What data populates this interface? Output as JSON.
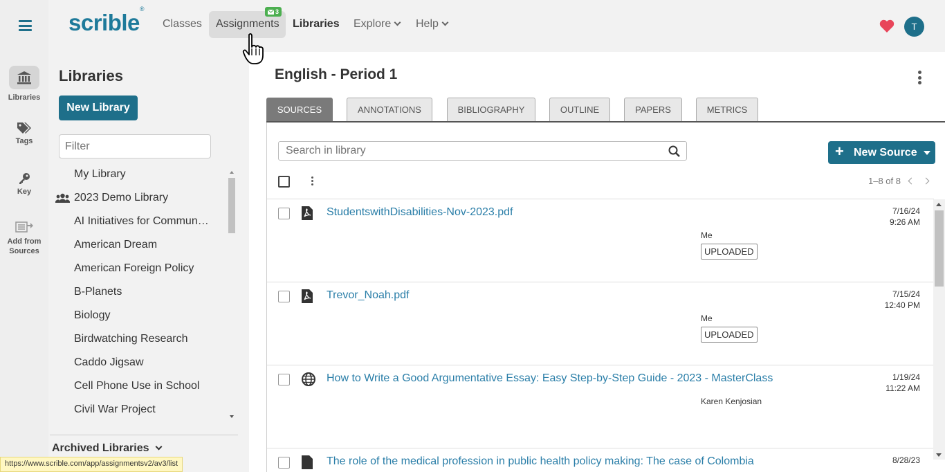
{
  "rail": {
    "items": [
      {
        "label": "Libraries",
        "icon": "library-icon"
      },
      {
        "label": "Tags",
        "icon": "tags-icon"
      },
      {
        "label": "Key",
        "icon": "key-icon"
      },
      {
        "label": "Add from Sources",
        "icon": "add-from-sources-icon"
      }
    ]
  },
  "header": {
    "logo": "scrible",
    "logo_mark": "®",
    "nav": {
      "classes": "Classes",
      "assignments": "Assignments",
      "assignments_badge": "3",
      "libraries": "Libraries",
      "explore": "Explore",
      "help": "Help"
    },
    "avatar_initial": "T",
    "accent": "#1e6f8a",
    "heart_color": "#e8455a"
  },
  "sidebar": {
    "title": "Libraries",
    "new_library": "New Library",
    "filter_placeholder": "Filter",
    "libraries": [
      "My Library",
      "2023 Demo Library",
      "AI Initiatives for Communities",
      "American Dream",
      "American Foreign Policy",
      "B-Planets",
      "Biology",
      "Birdwatching Research",
      "Caddo Jigsaw",
      "Cell Phone Use in School",
      "Civil War Project"
    ],
    "archived": "Archived Libraries"
  },
  "main": {
    "title": "English - Period 1",
    "tabs": [
      "SOURCES",
      "ANNOTATIONS",
      "BIBLIOGRAPHY",
      "OUTLINE",
      "PAPERS",
      "METRICS"
    ],
    "active_tab": "SOURCES",
    "search_placeholder": "Search in library",
    "new_source": "New Source",
    "paging": "1–8 of 8",
    "sources": [
      {
        "title": "StudentswithDisabilities-Nov-2023.pdf",
        "type": "pdf-icon",
        "date": "7/16/24",
        "time": "9:26 AM",
        "owner": "Me",
        "status": "UPLOADED"
      },
      {
        "title": "Trevor_Noah.pdf",
        "type": "pdf-icon",
        "date": "7/15/24",
        "time": "12:40 PM",
        "owner": "Me",
        "status": "UPLOADED"
      },
      {
        "title": "How to Write a Good Argumentative Essay: Easy Step-by-Step Guide - 2023 - MasterClass",
        "type": "globe-icon",
        "date": "1/19/24",
        "time": "11:22 AM",
        "owner": "Karen Kenjosian",
        "status": ""
      },
      {
        "title": "The role of the medical profession in public health policy making: The case of Colombia",
        "type": "pdf-icon",
        "date": "8/28/23",
        "time": "",
        "owner": "",
        "status": ""
      }
    ]
  },
  "statusbar": "https://www.scrible.com/app/assignmentsv2/av3/list"
}
